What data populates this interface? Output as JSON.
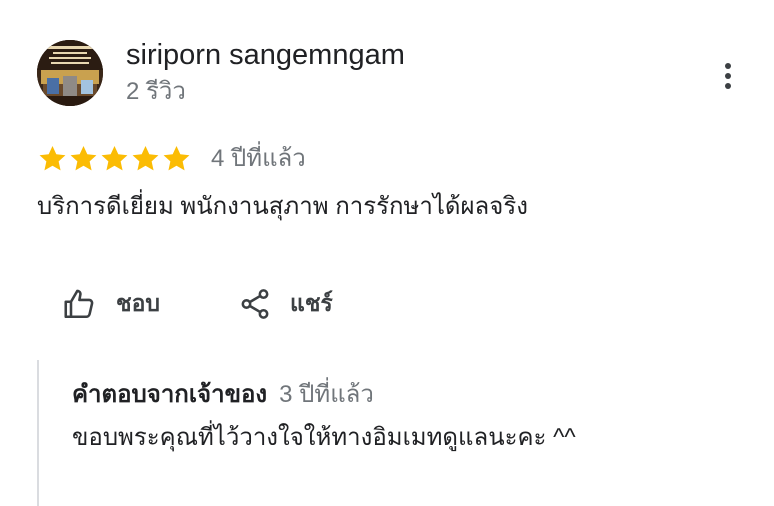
{
  "review": {
    "reviewer_name": "siriporn sangemngam",
    "review_count": "2 รีวิว",
    "rating": 5,
    "rating_max": 5,
    "star_color": "#fbbc04",
    "date": "4 ปีที่แล้ว",
    "text": "บริการดีเยี่ยม พนักงานสุภาพ การรักษาได้ผลจริง",
    "avatar_icon": "business-logo-avatar",
    "more_icon": "more-vertical-icon"
  },
  "actions": {
    "like_label": "ชอบ",
    "like_icon": "thumbs-up-icon",
    "share_label": "แชร์",
    "share_icon": "share-icon"
  },
  "owner_reply": {
    "label": "คำตอบจากเจ้าของ",
    "date": "3 ปีที่แล้ว",
    "text": "ขอบพระคุณที่ไว้วางใจให้ทางอิมเมทดูแลนะคะ ^^"
  }
}
